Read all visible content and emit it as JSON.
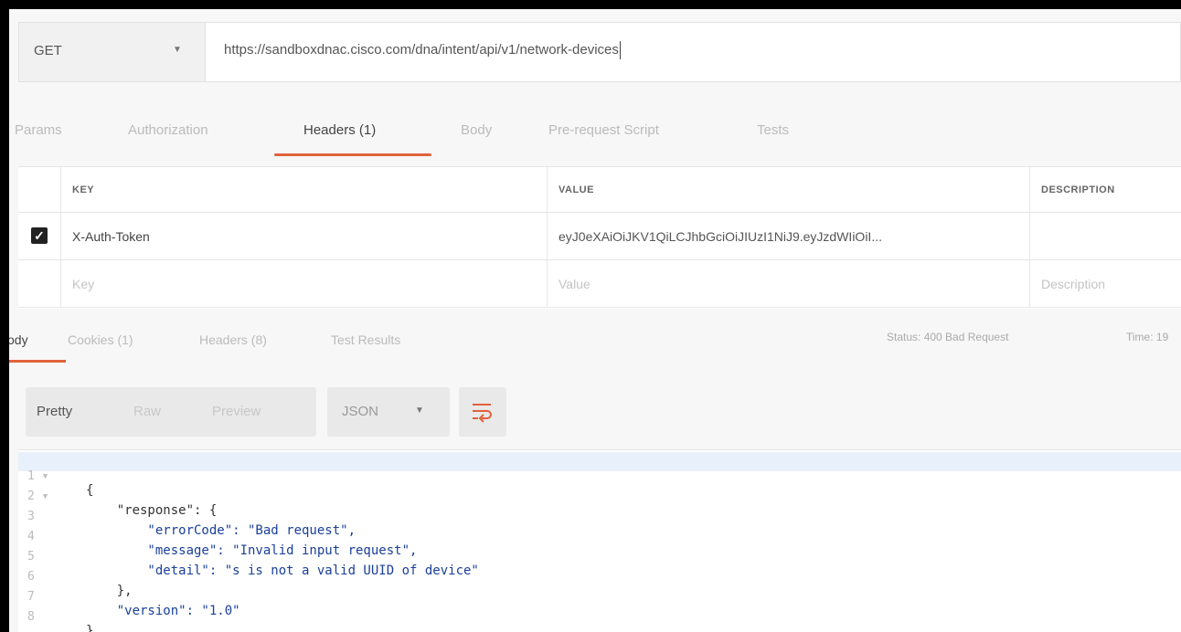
{
  "request": {
    "method": "GET",
    "url": "https://sandboxdnac.cisco.com/dna/intent/api/v1/network-devices"
  },
  "request_tabs": [
    {
      "label": "Params"
    },
    {
      "label": "Authorization"
    },
    {
      "label": "Headers (1)"
    },
    {
      "label": "Body"
    },
    {
      "label": "Pre-request Script"
    },
    {
      "label": "Tests"
    }
  ],
  "headers_table": {
    "columns": [
      "KEY",
      "VALUE",
      "DESCRIPTION"
    ],
    "rows": [
      {
        "checked": true,
        "key": "X-Auth-Token",
        "value": "eyJ0eXAiOiJKV1QiLCJhbGciOiJIUzI1NiJ9.eyJzdWIiOiI...",
        "description": ""
      }
    ],
    "placeholder": {
      "key": "Key",
      "value": "Value",
      "description": "Description"
    }
  },
  "response_tabs": [
    {
      "label": "ody"
    },
    {
      "label": "Cookies (1)"
    },
    {
      "label": "Headers (8)"
    },
    {
      "label": "Test Results"
    }
  ],
  "response_status": {
    "status": "Status: 400 Bad Request",
    "time": "Time: 19"
  },
  "view_modes": [
    "Pretty",
    "Raw",
    "Preview"
  ],
  "format": "JSON",
  "icons": {
    "method_dropdown": "chevron-down-icon",
    "format_dropdown": "chevron-down-icon",
    "wrap": "wrap-lines-icon",
    "checkbox": "checkbox-checked-icon"
  },
  "colors": {
    "accent": "#e0623c",
    "string": "#1a3f9a"
  },
  "code_lines": [
    {
      "num": "1",
      "fold": "▾",
      "text": "{"
    },
    {
      "num": "2",
      "fold": "▾",
      "text": "    \"response\": {"
    },
    {
      "num": "3",
      "fold": "",
      "text": "        \"errorCode\": \"Bad request\","
    },
    {
      "num": "4",
      "fold": "",
      "text": "        \"message\": \"Invalid input request\","
    },
    {
      "num": "5",
      "fold": "",
      "text": "        \"detail\": \"s is not a valid UUID of device\""
    },
    {
      "num": "6",
      "fold": "",
      "text": "    },"
    },
    {
      "num": "7",
      "fold": "",
      "text": "    \"version\": \"1.0\""
    },
    {
      "num": "8",
      "fold": "",
      "text": "}"
    }
  ]
}
